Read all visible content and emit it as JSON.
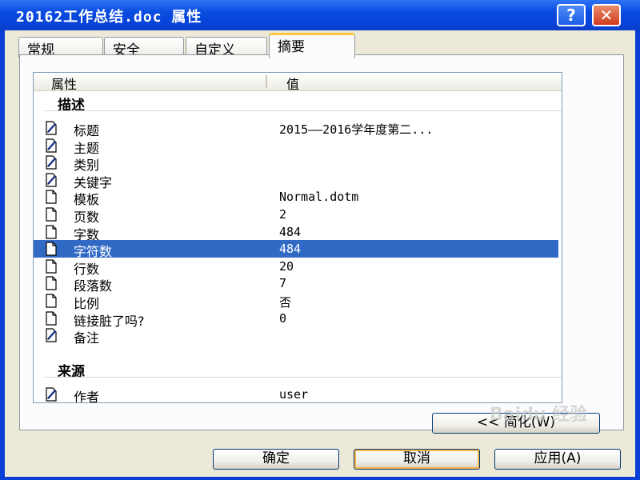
{
  "window": {
    "title": "20162工作总结.doc 属性",
    "help_glyph": "?",
    "close_glyph": "✕"
  },
  "tabs": [
    {
      "label": "常规",
      "active": false
    },
    {
      "label": "安全",
      "active": false
    },
    {
      "label": "自定义",
      "active": false
    },
    {
      "label": "摘要",
      "active": true
    }
  ],
  "list": {
    "columns": [
      "属性",
      "值"
    ],
    "groups": [
      {
        "name": "描述",
        "rows": [
          {
            "name": "标题",
            "value": "2015——2016学年度第二...",
            "icon": "editable-doc-icon"
          },
          {
            "name": "主题",
            "value": "",
            "icon": "editable-doc-icon"
          },
          {
            "name": "类别",
            "value": "",
            "icon": "editable-doc-icon"
          },
          {
            "name": "关键字",
            "value": "",
            "icon": "editable-doc-icon"
          },
          {
            "name": "模板",
            "value": "Normal.dotm",
            "icon": "doc-icon"
          },
          {
            "name": "页数",
            "value": "2",
            "icon": "doc-icon"
          },
          {
            "name": "字数",
            "value": "484",
            "icon": "doc-icon"
          },
          {
            "name": "字符数",
            "value": "484",
            "icon": "doc-icon",
            "selected": true
          },
          {
            "name": "行数",
            "value": "20",
            "icon": "doc-icon"
          },
          {
            "name": "段落数",
            "value": "7",
            "icon": "doc-icon"
          },
          {
            "name": "比例",
            "value": "否",
            "icon": "doc-icon"
          },
          {
            "name": "链接脏了吗?",
            "value": "0",
            "icon": "doc-icon"
          },
          {
            "name": "备注",
            "value": "",
            "icon": "editable-doc-icon"
          }
        ]
      },
      {
        "name": "来源",
        "rows": [
          {
            "name": "作者",
            "value": "user",
            "icon": "editable-doc-icon"
          }
        ]
      }
    ]
  },
  "scroll": {
    "up_glyph": "︿",
    "down_glyph": "﹀"
  },
  "buttons": {
    "simple": "<< 简化(W)",
    "ok": "确定",
    "cancel": "取消",
    "apply": "应用(A)"
  },
  "watermark": "Baidu 经验",
  "colors": {
    "selection": "#316ac5",
    "titlebar": "#0a4be0",
    "face": "#ece9d8"
  }
}
